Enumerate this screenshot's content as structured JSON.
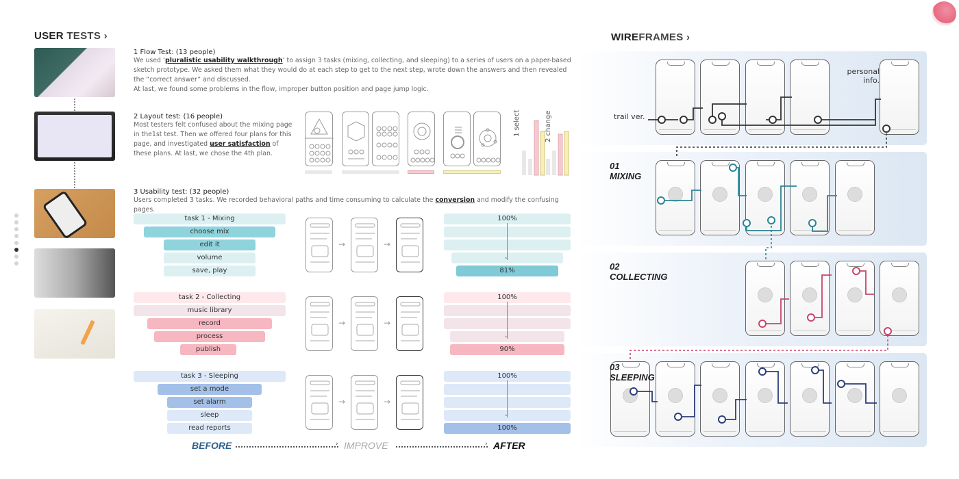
{
  "left": {
    "title_bold": "USER",
    "title_rest": " TESTS",
    "chevron": "›",
    "photos": [
      {
        "name": "paper-prototype-photo",
        "desc": "hand pointing at paper prototype"
      },
      {
        "name": "tablet-layout-photo",
        "desc": "tablet with wireframe layouts"
      },
      {
        "name": "phone-usability-photo",
        "desc": "hands holding phone"
      },
      {
        "name": "whiteboard-photo",
        "desc": "hand writing on whiteboard"
      },
      {
        "name": "notebook-photo",
        "desc": "notebook with pen"
      }
    ],
    "page_dots": {
      "count": 8,
      "active_index": 5
    },
    "flow_test": {
      "heading": "1 Flow Test: (13 people)",
      "p1_a": "We used ‘",
      "p1_link": "pluralistic usability walkthrough",
      "p1_b": "’ to assign 3 tasks (mixing, collecting, and sleeping) to a series of users on a paper-based sketch prototype. We asked them what they would do at each step to get to the next step, wrote down the answers and then revealed the “correct answer” and discussed.",
      "p2": "At last, we found some problems in the flow, improper button position and page jump logic."
    },
    "layout_test": {
      "heading": "2 Layout test: (16 people)",
      "p_a": "Most testers felt confused about the mixing page in the1st test.  Then we offered four plans for this page, and investigated ",
      "p_link": "user satisfaction",
      "p_b": " of these plans. At last, we chose the 4th plan.",
      "legend_select": "1 select",
      "legend_change": "2 change",
      "select_values": [
        0.45,
        0.3,
        1.0,
        0.8
      ],
      "change_values": [
        0.3,
        0.45,
        0.75,
        0.8
      ],
      "colors": {
        "pink": "#f6c9d0",
        "yellow": "#f7efb4",
        "gray": "#e8e8e8"
      }
    },
    "usability_test": {
      "heading": "3 Usability test: (32 people)",
      "p_a": "Users completed 3 tasks. We recorded behavioral paths and time consuming to calculate the ",
      "p_link": "conversion",
      "p_b": " and modify the confusing pages.",
      "tasks": [
        {
          "title": "task 1 - Mixing",
          "steps": [
            "choose mix",
            "edit it",
            "volume",
            "save, play"
          ],
          "start": "100%",
          "end": "81%",
          "light": "#dcf0f2",
          "strong": "#8fd3dc",
          "end_color": "#7fcad6"
        },
        {
          "title": "task 2 - Collecting",
          "steps": [
            "music library",
            "record",
            "process",
            "publish"
          ],
          "start": "100%",
          "end": "90%",
          "light": "#fde9ec",
          "mid": "#f3e4ea",
          "strong": "#f7b7c0",
          "end_color": "#f7b7c0"
        },
        {
          "title": "task 3 - Sleeping",
          "steps": [
            "set a mode",
            "set alarm",
            "sleep",
            "read reports"
          ],
          "start": "100%",
          "end": "100%",
          "light": "#dde9f9",
          "strong": "#a3c0e8",
          "end_color": "#a3c0e8"
        }
      ],
      "flow_before": "BEFORE",
      "flow_improve": "IMPROVE",
      "flow_after": "AFTER"
    }
  },
  "right": {
    "title_bold": "WIRE",
    "title_rest": "FRAMES",
    "chevron": "›",
    "trail_label": "trail ver.",
    "personal_label_1": "personal",
    "personal_label_2": "info.",
    "sections": [
      {
        "num": "01",
        "name": "MIXING",
        "accent": "#2a8595"
      },
      {
        "num": "02",
        "name": "COLLECTING",
        "accent": "#c8456a"
      },
      {
        "num": "03",
        "name": "SLEEPING",
        "accent": "#2c3e78"
      }
    ]
  }
}
